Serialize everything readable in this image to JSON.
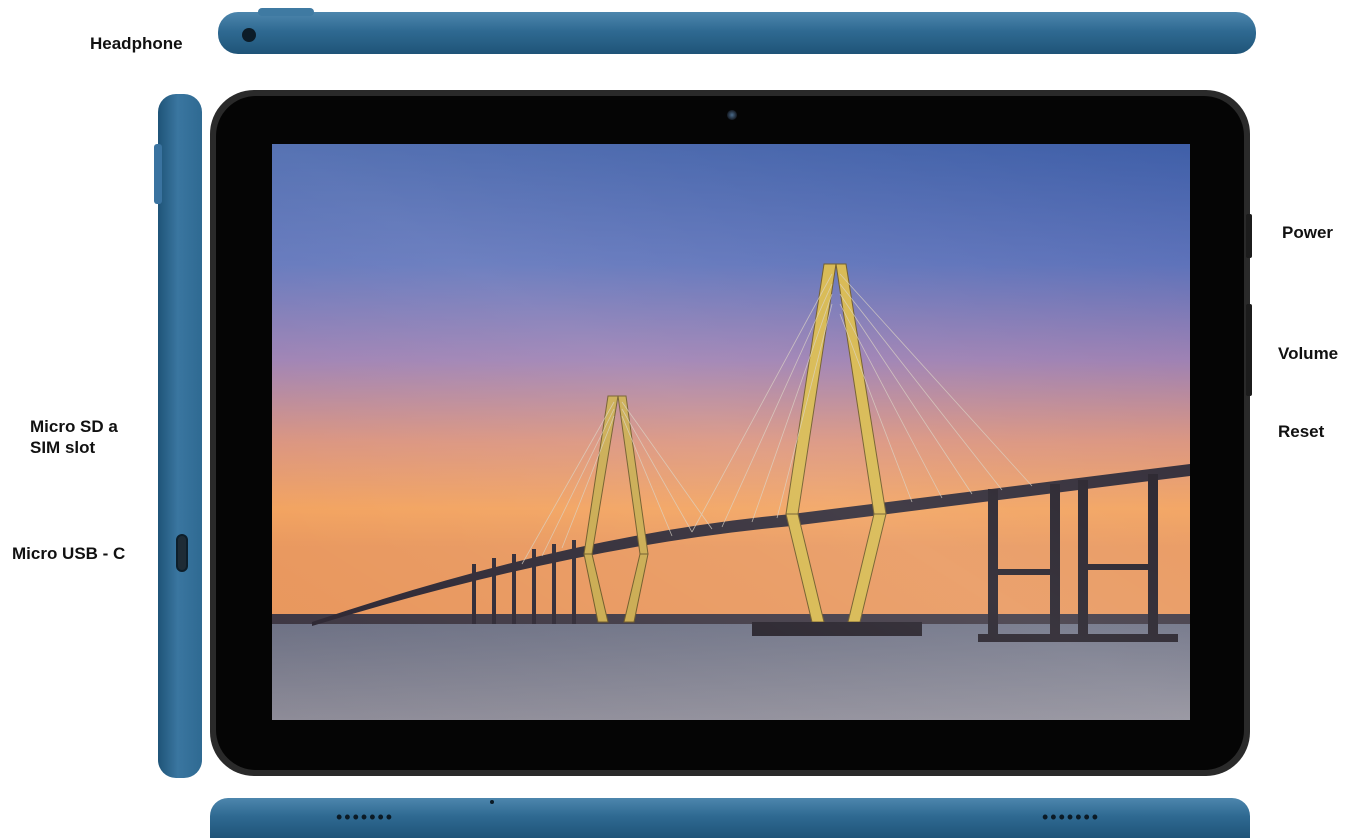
{
  "labels": {
    "headphone": "Headphone",
    "power": "Power",
    "volume": "Volume",
    "reset": "Reset",
    "micro_sd": "Micro SD a SIM slot",
    "micro_usb": "Micro USB - C"
  },
  "colors": {
    "tablet_body": "#2f6a92",
    "bezel": "#050505",
    "label_text": "#111111"
  },
  "icons": {
    "headphone_jack": "headphone-jack-icon",
    "camera": "front-camera-icon",
    "usb": "usb-c-port-icon"
  }
}
